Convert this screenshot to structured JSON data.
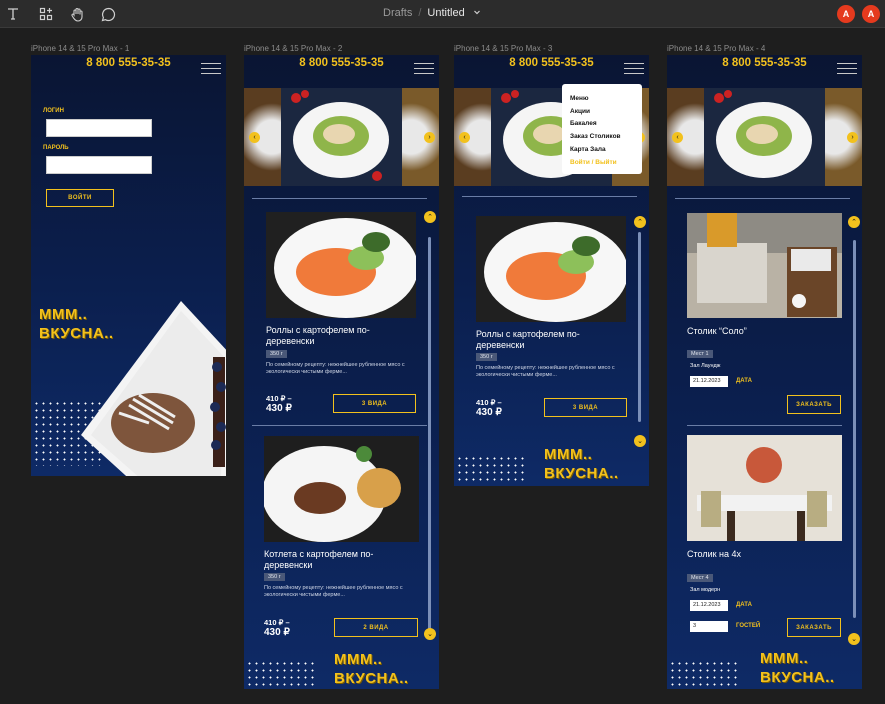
{
  "toolbar": {
    "breadcrumb_root": "Drafts",
    "breadcrumb_sep": "/",
    "file_name": "Untitled",
    "avatar_1": "A",
    "avatar_2": "A"
  },
  "frames": [
    {
      "label": "iPhone 14 & 15 Pro Max - 1"
    },
    {
      "label": "iPhone 14 & 15 Pro Max - 2"
    },
    {
      "label": "iPhone 14 & 15 Pro Max - 3"
    },
    {
      "label": "iPhone 14 & 15 Pro Max - 4"
    }
  ],
  "phone": "8 800 555-35-35",
  "login": {
    "login_label": "ЛОГИН",
    "password_label": "ПАРОЛЬ",
    "submit_label": "ВОЙТИ"
  },
  "slogan": {
    "line1": "МММ..",
    "line2": "ВКУСНА.."
  },
  "menu": {
    "items": [
      "Меню",
      "Акции",
      "Бакалея",
      "Заказ Столиков",
      "Карта Зала",
      "Войти / Выйти"
    ]
  },
  "dishes": [
    {
      "title": "Роллы с картофелем по-деревенски",
      "weight": "350 г",
      "desc": "По семейному рецепту: нежнейшее рубленное мясо с экологически чистыми ферме...",
      "price_from": "410 ₽ –",
      "price_to": "430 ₽",
      "button": "3 ВИДА"
    },
    {
      "title": "Котлета с картофелем по-деревенски",
      "weight": "350 г",
      "desc": "По семейному рецепту: нежнейшее рубленное мясо с экологически чистыми ферме...",
      "price_from": "410 ₽ –",
      "price_to": "430 ₽",
      "button": "2 ВИДА"
    }
  ],
  "tables": [
    {
      "title": "Столик “Соло”",
      "places": "Мест 1",
      "hall": "Зал Лаундж",
      "date": "21.12.2023",
      "date_label": "ДАТА",
      "button": "ЗАКАЗАТЬ"
    },
    {
      "title": "Столик на 4х",
      "places": "Мест 4",
      "hall": "Зал модерн",
      "date": "21.12.2023",
      "date_label": "ДАТА",
      "guests": "3",
      "guests_label": "ГОСТЕЙ",
      "button": "ЗАКАЗАТЬ"
    }
  ],
  "colors": {
    "accent": "#f2c11d",
    "bg_dark": "#0a1533",
    "canvas": "#1e1e1e"
  }
}
